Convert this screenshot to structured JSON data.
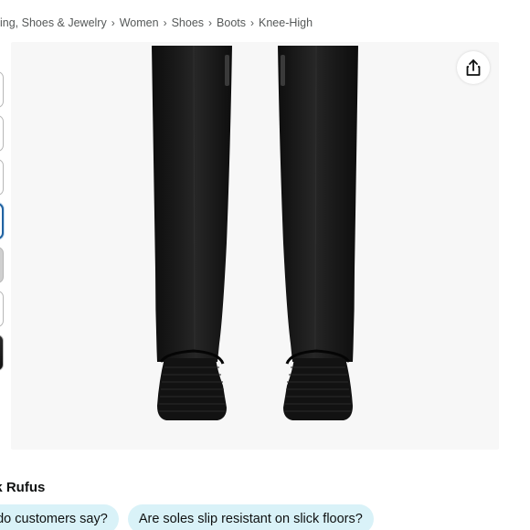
{
  "breadcrumb": {
    "items": [
      "ing, Shoes & Jewelry",
      "Women",
      "Shoes",
      "Boots",
      "Knee-High"
    ],
    "separator": "›"
  },
  "thumbnails": {
    "count": 7,
    "selected_index": 3
  },
  "product_image": {
    "subject": "black knee-high boots, rear view"
  },
  "share": {
    "icon": "share-icon"
  },
  "rufus": {
    "title": "sk Rufus",
    "chips": [
      "at do customers say?",
      "Are soles slip resistant on slick floors?"
    ]
  },
  "colors": {
    "chip_bg": "#d9f2f8",
    "thumb_selected_border": "#2162a1",
    "image_bg": "#f7f7f7",
    "boot": "#141414"
  }
}
